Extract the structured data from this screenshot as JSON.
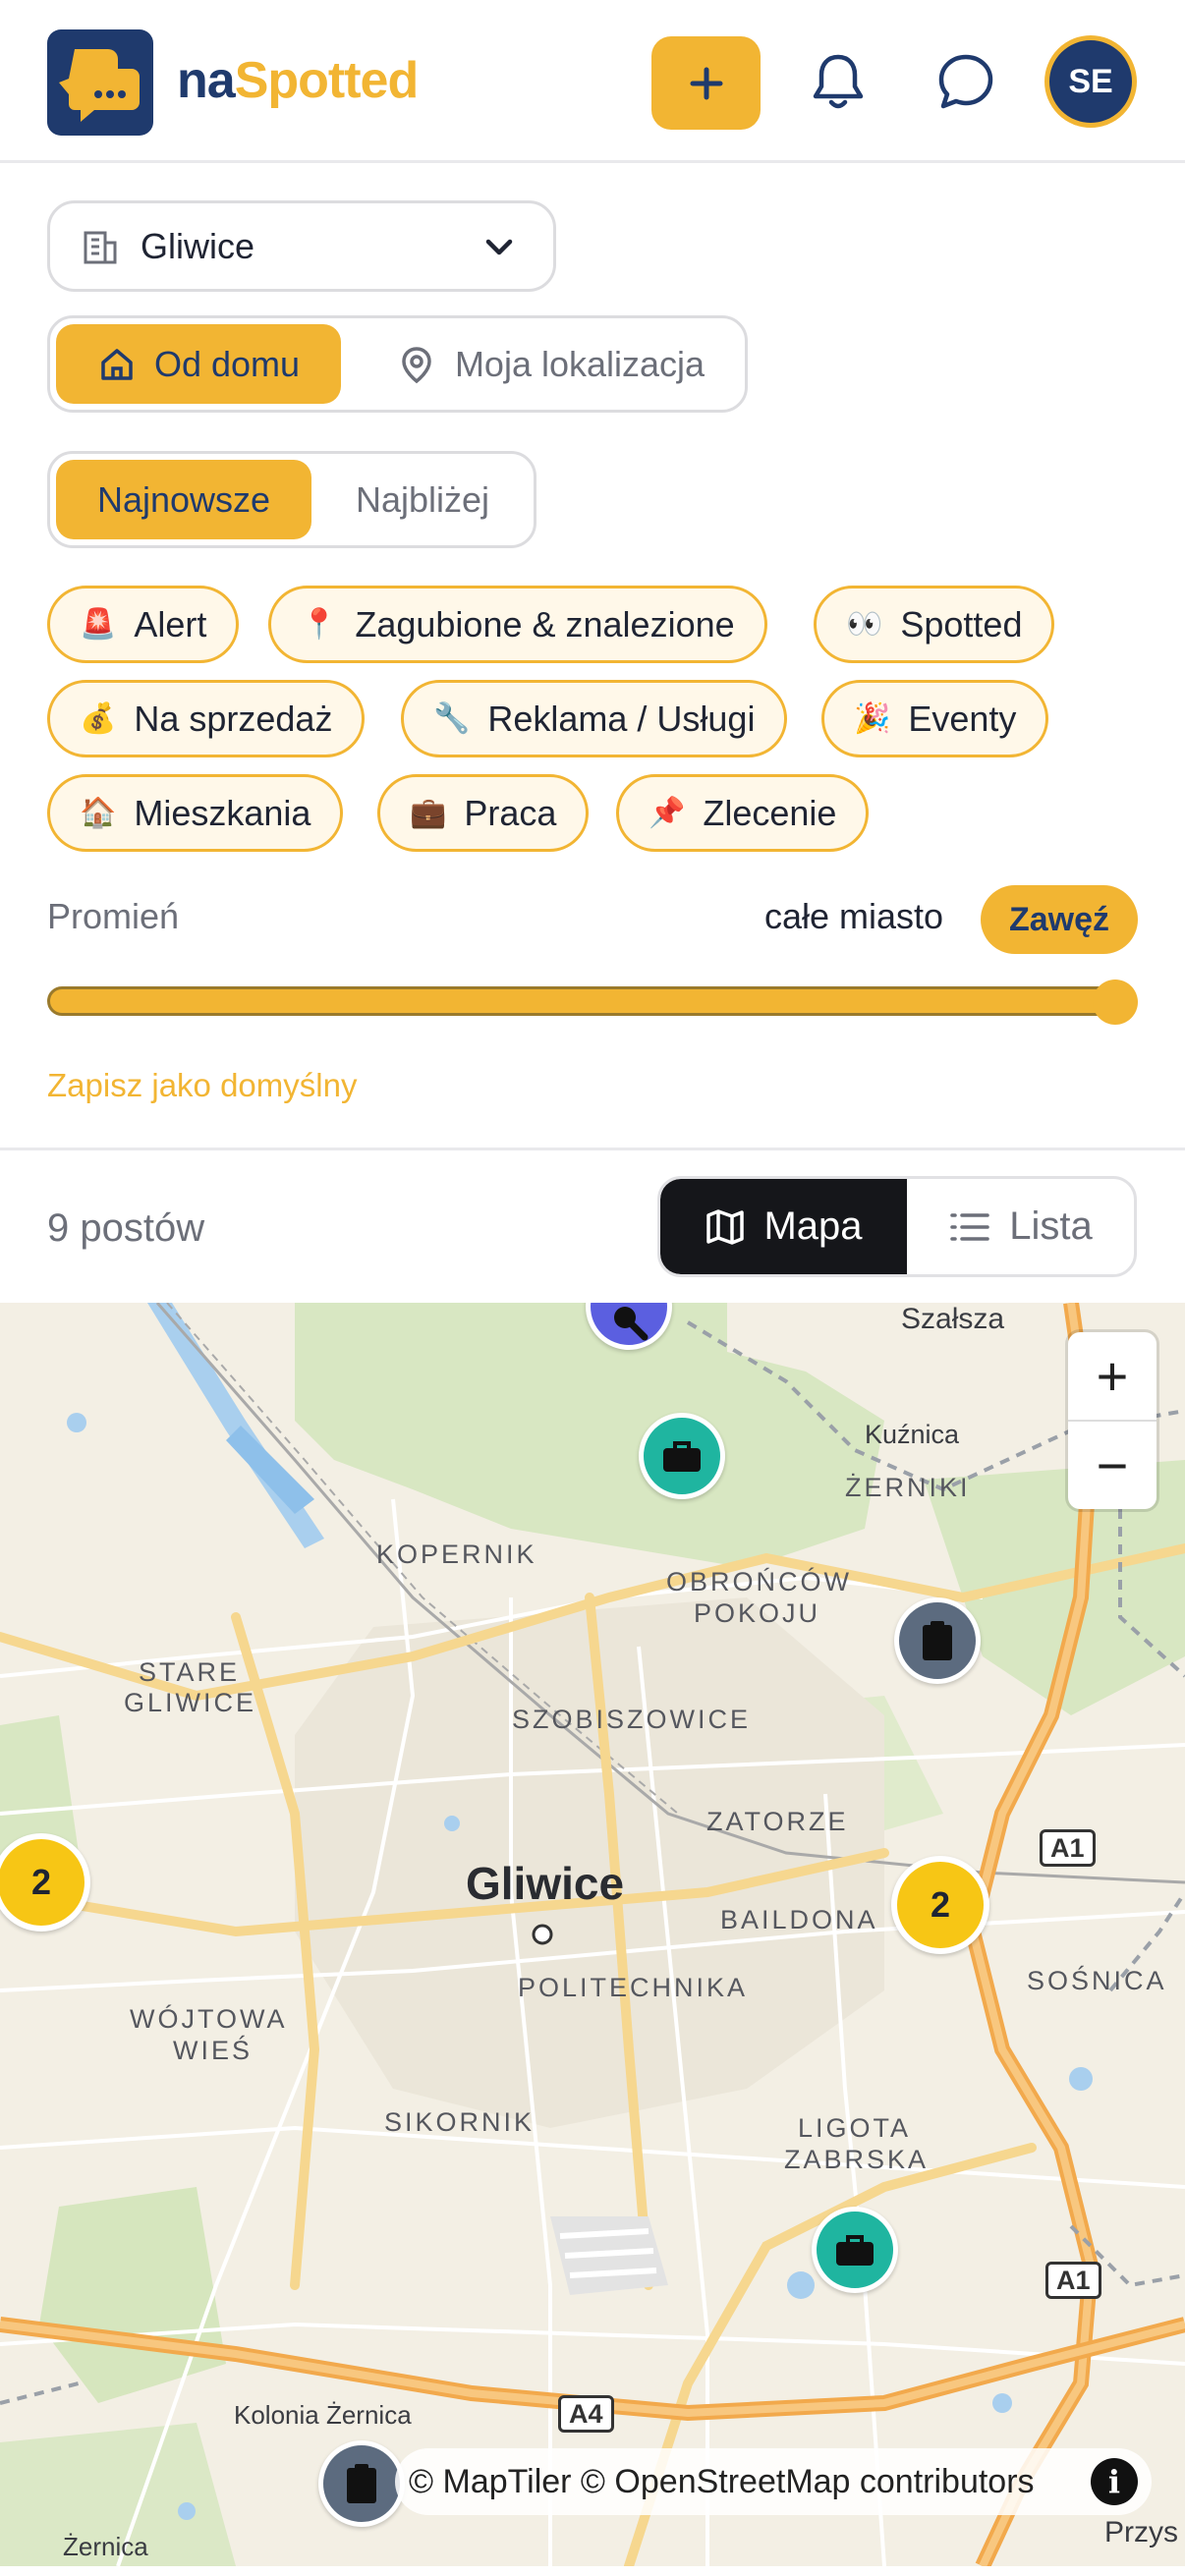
{
  "header": {
    "brand_part1": "na",
    "brand_part2": "Spotted",
    "add_label": "+",
    "avatar_initials": "SE",
    "icons": [
      "plus-icon",
      "bell-icon",
      "chat-icon"
    ]
  },
  "filters": {
    "city": "Gliwice",
    "location_modes": [
      "Od domu",
      "Moja lokalizacja"
    ],
    "location_active": "Od domu",
    "sort_modes": [
      "Najnowsze",
      "Najbliżej"
    ],
    "sort_active": "Najnowsze",
    "categories": [
      {
        "emoji": "🚨",
        "label": "Alert"
      },
      {
        "emoji": "📍",
        "label": "Zagubione & znalezione"
      },
      {
        "emoji": "👀",
        "label": "Spotted"
      },
      {
        "emoji": "💰",
        "label": "Na sprzedaż"
      },
      {
        "emoji": "🔧",
        "label": "Reklama / Usługi"
      },
      {
        "emoji": "🎉",
        "label": "Eventy"
      },
      {
        "emoji": "🏠",
        "label": "Mieszkania"
      },
      {
        "emoji": "💼",
        "label": "Praca"
      },
      {
        "emoji": "📌",
        "label": "Zlecenie"
      }
    ],
    "radius_label": "Promień",
    "radius_value": "całe miasto",
    "radius_level": 1.0,
    "narrow_label": "Zawęź",
    "save_default": "Zapisz jako domyślny"
  },
  "results": {
    "count_label": "9 postów",
    "view_map": "Mapa",
    "view_list": "Lista",
    "view_active": "Mapa"
  },
  "map": {
    "labels": {
      "szalsza": "Szałsza",
      "kuznica": "Kuźnica",
      "zerniki": "ŻERNIKI",
      "kopernik": "KOPERNIK",
      "obroncow1": "OBROŃCÓW",
      "obroncow2": "POKOJU",
      "stare1": "STARE",
      "stare2": "GLIWICE",
      "szobiszowice": "SZOBISZOWICE",
      "zatorze": "ZATORZE",
      "gliwice": "Gliwice",
      "baildona": "BAILDONA",
      "sosnica": "SOŚNICA",
      "politechnika": "POLITECHNIKA",
      "wojtowa1": "WÓJTOWA",
      "wojtowa2": "WIEŚ",
      "sikornik": "SIKORNIK",
      "ligota1": "LIGOTA",
      "ligota2": "ZABRSKA",
      "kolonia": "Kolonia Żernica",
      "zernica": "Żernica",
      "przys": "Przys"
    },
    "road_badges": {
      "a1_top": "A1",
      "a1_bottom": "A1",
      "a4": "A4"
    },
    "clusters": [
      "2",
      "2"
    ],
    "zoom_in": "+",
    "zoom_out": "−",
    "attribution": "© MapTiler © OpenStreetMap contributors",
    "info": "i",
    "colors": {
      "accent": "#f2b533",
      "navy": "#1f3a6d",
      "teal": "#1fb5a0",
      "slate": "#5c6b7f",
      "indigo": "#5b5fe0",
      "cluster": "#f7c615"
    }
  }
}
